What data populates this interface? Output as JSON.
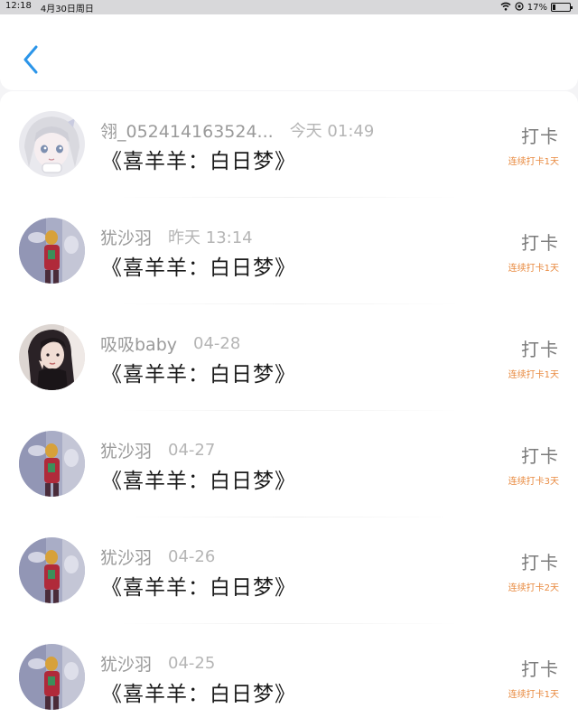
{
  "status_bar": {
    "time": "12:18",
    "date": "4月30日周日",
    "battery": "17%",
    "battery_level": 0.17
  },
  "nav": {
    "back_icon": "chevron-left-icon"
  },
  "colors": {
    "accent": "#2b95e9",
    "streak": "#e8893e"
  },
  "records": [
    {
      "username": "翎_052414163524...",
      "time": "今天 01:49",
      "title": "《喜羊羊：白日梦》",
      "action": "打卡",
      "streak": "连续打卡1天",
      "avatar": "anime-avatar"
    },
    {
      "username": "犹沙羽",
      "time": "昨天 13:14",
      "title": "《喜羊羊：白日梦》",
      "action": "打卡",
      "streak": "连续打卡1天",
      "avatar": "blurred-photo-avatar"
    },
    {
      "username": "吸吸baby",
      "time": "04-28",
      "title": "《喜羊羊：白日梦》",
      "action": "打卡",
      "streak": "连续打卡1天",
      "avatar": "girl-photo-avatar"
    },
    {
      "username": "犹沙羽",
      "time": "04-27",
      "title": "《喜羊羊：白日梦》",
      "action": "打卡",
      "streak": "连续打卡3天",
      "avatar": "blurred-photo-avatar"
    },
    {
      "username": "犹沙羽",
      "time": "04-26",
      "title": "《喜羊羊：白日梦》",
      "action": "打卡",
      "streak": "连续打卡2天",
      "avatar": "blurred-photo-avatar"
    },
    {
      "username": "犹沙羽",
      "time": "04-25",
      "title": "《喜羊羊：白日梦》",
      "action": "打卡",
      "streak": "连续打卡1天",
      "avatar": "blurred-photo-avatar"
    }
  ]
}
